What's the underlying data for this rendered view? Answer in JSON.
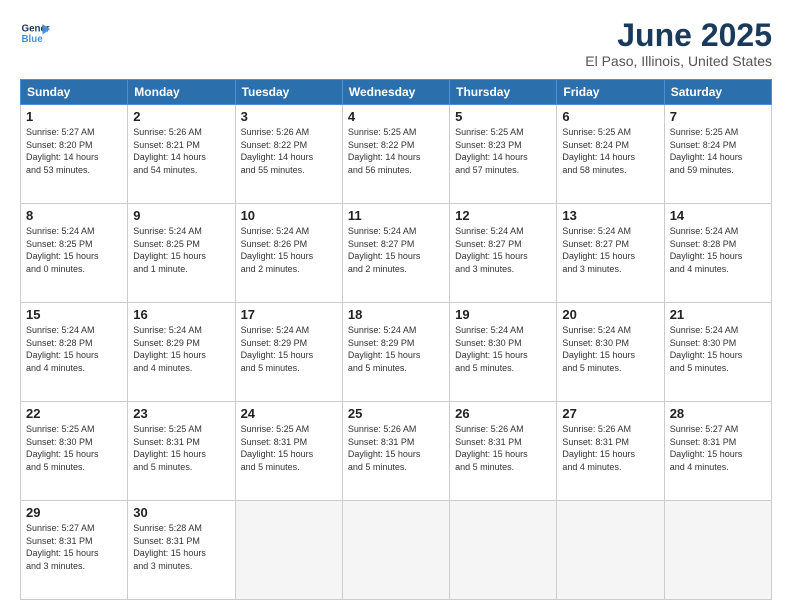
{
  "logo": {
    "line1": "General",
    "line2": "Blue"
  },
  "title": "June 2025",
  "subtitle": "El Paso, Illinois, United States",
  "days_of_week": [
    "Sunday",
    "Monday",
    "Tuesday",
    "Wednesday",
    "Thursday",
    "Friday",
    "Saturday"
  ],
  "weeks": [
    [
      {
        "day": 1,
        "info": "Sunrise: 5:27 AM\nSunset: 8:20 PM\nDaylight: 14 hours\nand 53 minutes."
      },
      {
        "day": 2,
        "info": "Sunrise: 5:26 AM\nSunset: 8:21 PM\nDaylight: 14 hours\nand 54 minutes."
      },
      {
        "day": 3,
        "info": "Sunrise: 5:26 AM\nSunset: 8:22 PM\nDaylight: 14 hours\nand 55 minutes."
      },
      {
        "day": 4,
        "info": "Sunrise: 5:25 AM\nSunset: 8:22 PM\nDaylight: 14 hours\nand 56 minutes."
      },
      {
        "day": 5,
        "info": "Sunrise: 5:25 AM\nSunset: 8:23 PM\nDaylight: 14 hours\nand 57 minutes."
      },
      {
        "day": 6,
        "info": "Sunrise: 5:25 AM\nSunset: 8:24 PM\nDaylight: 14 hours\nand 58 minutes."
      },
      {
        "day": 7,
        "info": "Sunrise: 5:25 AM\nSunset: 8:24 PM\nDaylight: 14 hours\nand 59 minutes."
      }
    ],
    [
      {
        "day": 8,
        "info": "Sunrise: 5:24 AM\nSunset: 8:25 PM\nDaylight: 15 hours\nand 0 minutes."
      },
      {
        "day": 9,
        "info": "Sunrise: 5:24 AM\nSunset: 8:25 PM\nDaylight: 15 hours\nand 1 minute."
      },
      {
        "day": 10,
        "info": "Sunrise: 5:24 AM\nSunset: 8:26 PM\nDaylight: 15 hours\nand 2 minutes."
      },
      {
        "day": 11,
        "info": "Sunrise: 5:24 AM\nSunset: 8:27 PM\nDaylight: 15 hours\nand 2 minutes."
      },
      {
        "day": 12,
        "info": "Sunrise: 5:24 AM\nSunset: 8:27 PM\nDaylight: 15 hours\nand 3 minutes."
      },
      {
        "day": 13,
        "info": "Sunrise: 5:24 AM\nSunset: 8:27 PM\nDaylight: 15 hours\nand 3 minutes."
      },
      {
        "day": 14,
        "info": "Sunrise: 5:24 AM\nSunset: 8:28 PM\nDaylight: 15 hours\nand 4 minutes."
      }
    ],
    [
      {
        "day": 15,
        "info": "Sunrise: 5:24 AM\nSunset: 8:28 PM\nDaylight: 15 hours\nand 4 minutes."
      },
      {
        "day": 16,
        "info": "Sunrise: 5:24 AM\nSunset: 8:29 PM\nDaylight: 15 hours\nand 4 minutes."
      },
      {
        "day": 17,
        "info": "Sunrise: 5:24 AM\nSunset: 8:29 PM\nDaylight: 15 hours\nand 5 minutes."
      },
      {
        "day": 18,
        "info": "Sunrise: 5:24 AM\nSunset: 8:29 PM\nDaylight: 15 hours\nand 5 minutes."
      },
      {
        "day": 19,
        "info": "Sunrise: 5:24 AM\nSunset: 8:30 PM\nDaylight: 15 hours\nand 5 minutes."
      },
      {
        "day": 20,
        "info": "Sunrise: 5:24 AM\nSunset: 8:30 PM\nDaylight: 15 hours\nand 5 minutes."
      },
      {
        "day": 21,
        "info": "Sunrise: 5:24 AM\nSunset: 8:30 PM\nDaylight: 15 hours\nand 5 minutes."
      }
    ],
    [
      {
        "day": 22,
        "info": "Sunrise: 5:25 AM\nSunset: 8:30 PM\nDaylight: 15 hours\nand 5 minutes."
      },
      {
        "day": 23,
        "info": "Sunrise: 5:25 AM\nSunset: 8:31 PM\nDaylight: 15 hours\nand 5 minutes."
      },
      {
        "day": 24,
        "info": "Sunrise: 5:25 AM\nSunset: 8:31 PM\nDaylight: 15 hours\nand 5 minutes."
      },
      {
        "day": 25,
        "info": "Sunrise: 5:26 AM\nSunset: 8:31 PM\nDaylight: 15 hours\nand 5 minutes."
      },
      {
        "day": 26,
        "info": "Sunrise: 5:26 AM\nSunset: 8:31 PM\nDaylight: 15 hours\nand 5 minutes."
      },
      {
        "day": 27,
        "info": "Sunrise: 5:26 AM\nSunset: 8:31 PM\nDaylight: 15 hours\nand 4 minutes."
      },
      {
        "day": 28,
        "info": "Sunrise: 5:27 AM\nSunset: 8:31 PM\nDaylight: 15 hours\nand 4 minutes."
      }
    ],
    [
      {
        "day": 29,
        "info": "Sunrise: 5:27 AM\nSunset: 8:31 PM\nDaylight: 15 hours\nand 3 minutes."
      },
      {
        "day": 30,
        "info": "Sunrise: 5:28 AM\nSunset: 8:31 PM\nDaylight: 15 hours\nand 3 minutes."
      },
      null,
      null,
      null,
      null,
      null
    ]
  ]
}
